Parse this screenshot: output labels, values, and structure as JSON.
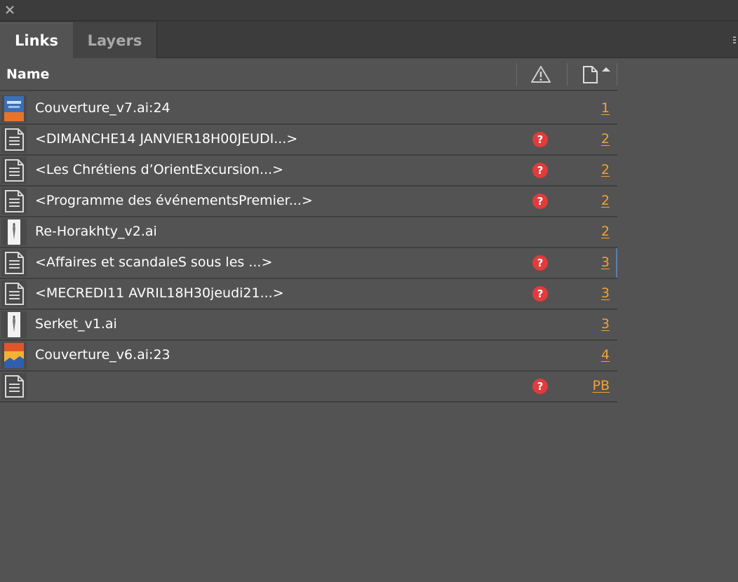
{
  "panel": {
    "tabs": [
      {
        "label": "Links",
        "active": true
      },
      {
        "label": "Layers",
        "active": false
      }
    ]
  },
  "header": {
    "name_label": "Name",
    "status_icon": "warning-triangle-icon",
    "page_icon": "page-icon",
    "sort": "ascending"
  },
  "colors": {
    "background": "#535353",
    "tabbar": "#3c3c3c",
    "page_link": "#f0a23a",
    "missing_badge": "#e23b3b"
  },
  "links": [
    {
      "name": "Couverture_v7.ai:24",
      "thumb": "image-blue-cover",
      "missing": false,
      "page": "1"
    },
    {
      "name": "<DIMANCHE14 JANVIER18H00JEUDI...>",
      "thumb": "text-document-icon",
      "missing": true,
      "page": "2"
    },
    {
      "name": "<Les Chrétiens d’OrientExcursion...>",
      "thumb": "text-document-icon",
      "missing": true,
      "page": "2"
    },
    {
      "name": "<Programme des événementsPremier...>",
      "thumb": "text-document-icon",
      "missing": true,
      "page": "2"
    },
    {
      "name": "Re-Horakhty_v2.ai",
      "thumb": "image-figure-white",
      "missing": false,
      "page": "2"
    },
    {
      "name": "<Affaires et scandaleS sous les ...>",
      "thumb": "text-document-icon",
      "missing": true,
      "page": "3"
    },
    {
      "name": "<MECREDI11 AVRIL18H30jeudi21...>",
      "thumb": "text-document-icon",
      "missing": true,
      "page": "3"
    },
    {
      "name": "Serket_v1.ai",
      "thumb": "image-figure-white",
      "missing": false,
      "page": "3"
    },
    {
      "name": "Couverture_v6.ai:23",
      "thumb": "image-sunset-cover",
      "missing": false,
      "page": "4"
    },
    {
      "name": "",
      "thumb": "text-document-icon",
      "missing": true,
      "page": "PB"
    }
  ],
  "missing_badge_glyph": "?"
}
